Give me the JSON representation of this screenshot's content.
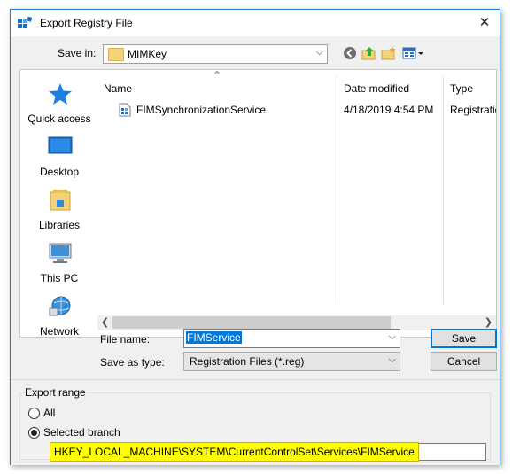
{
  "window": {
    "title": "Export Registry File",
    "close_glyph": "✕"
  },
  "toolbar": {
    "save_in_label": "Save in:",
    "save_in_value": "MIMKey",
    "icons": [
      "back-icon",
      "up-folder-icon",
      "new-folder-icon",
      "view-menu-icon"
    ]
  },
  "places": [
    {
      "label": "Quick access",
      "icon": "quick-access-star-icon"
    },
    {
      "label": "Desktop",
      "icon": "desktop-icon"
    },
    {
      "label": "Libraries",
      "icon": "libraries-icon"
    },
    {
      "label": "This PC",
      "icon": "this-pc-icon"
    },
    {
      "label": "Network",
      "icon": "network-icon"
    }
  ],
  "filelist": {
    "columns": [
      "Name",
      "Date modified",
      "Type"
    ],
    "rows": [
      {
        "name": "FIMSynchronizationService",
        "date": "4/18/2019 4:54 PM",
        "type": "Registratio",
        "icon": "registry-file-icon"
      }
    ]
  },
  "form": {
    "file_name_label": "File name:",
    "file_name_value": "FIMService",
    "save_as_type_label": "Save as type:",
    "save_as_type_value": "Registration Files (*.reg)",
    "save_button": "Save",
    "cancel_button": "Cancel"
  },
  "export_range": {
    "legend": "Export range",
    "option_all": "All",
    "option_selected": "Selected branch",
    "selected": "Selected branch",
    "branch_path": "HKEY_LOCAL_MACHINE\\SYSTEM\\CurrentControlSet\\Services\\FIMService"
  },
  "colors": {
    "accent": "#0078d7",
    "highlight": "#ffff00",
    "window_border": "#2b79d6"
  }
}
